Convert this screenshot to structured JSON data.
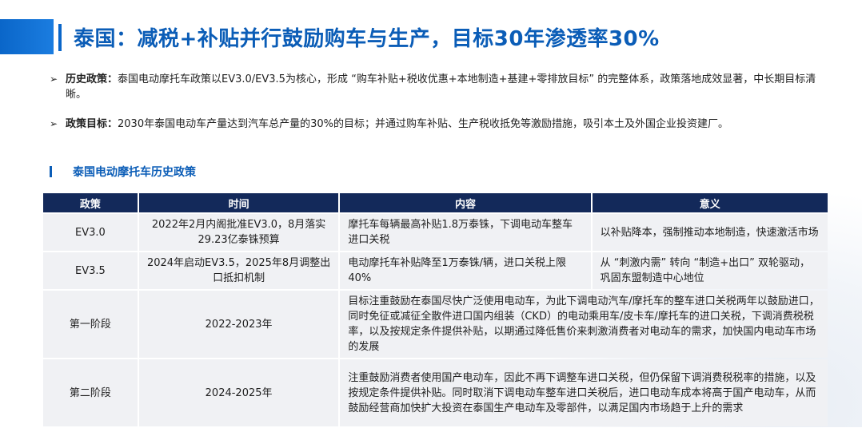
{
  "title": "泰国：减税+补贴并行鼓励购车与生产，目标30年渗透率30%",
  "bullets": [
    {
      "label": "历史政策：",
      "text": "泰国电动摩托车政策以EV3.0/EV3.5为核心，形成 “购车补贴+税收优惠+本地制造+基建+零排放目标” 的完整体系，政策落地成效显著，中长期目标清晰。"
    },
    {
      "label": "政策目标：",
      "text": "2030年泰国电动车产量达到汽车总产量的30%的目标；并通过购车补贴、生产税收抵免等激励措施，吸引本土及外国企业投资建厂。"
    }
  ],
  "table_title": "泰国电动摩托车历史政策",
  "table": {
    "headers": [
      "政策",
      "时间",
      "内容",
      "意义"
    ],
    "rows": [
      {
        "policy": "EV3.0",
        "time": "2022年2月内阁批准EV3.0，8月落实29.23亿泰铢预算",
        "content": "摩托车每辆最高补贴1.8万泰铢，下调电动车整车进口关税",
        "meaning": "以补贴降本，强制推动本地制造，快速激活市场"
      },
      {
        "policy": "EV3.5",
        "time": "2024年启动EV3.5，2025年8月调整出口抵扣机制",
        "content": "电动摩托车补贴降至1万泰铢/辆，进口关税上限40%",
        "meaning": "从 “刺激内需” 转向 “制造+出口” 双轮驱动，巩固东盟制造中心地位"
      },
      {
        "policy": "第一阶段",
        "time": "2022-2023年",
        "content": "目标注重鼓励在泰国尽快广泛使用电动车，为此下调电动汽车/摩托车的整车进口关税两年以鼓励进口，同时免征或减征全散件进口国内组装（CKD）的电动乘用车/皮卡车/摩托车的进口关税，下调消费税税率，以及按规定条件提供补贴，以期通过降低售价来刺激消费者对电动车的需求，加快国内电动车市场的发展"
      },
      {
        "policy": "第二阶段",
        "time": "2024-2025年",
        "content": "注重鼓励消费者使用国产电动车，因此不再下调整车进口关税，但仍保留下调消费税税率的措施，以及按规定条件提供补贴。同时取消下调电动车整车进口关税后，进口电动车成本将高于国产电动车，从而鼓励经营商加快扩大投资在泰国生产电动车及零部件，以满足国内市场趋于上升的需求"
      }
    ]
  },
  "colors": {
    "title": "#0b5db7",
    "header_bg": "#13295a",
    "cell_bg": "#f0f1f4",
    "accent": "#0a66c9"
  }
}
